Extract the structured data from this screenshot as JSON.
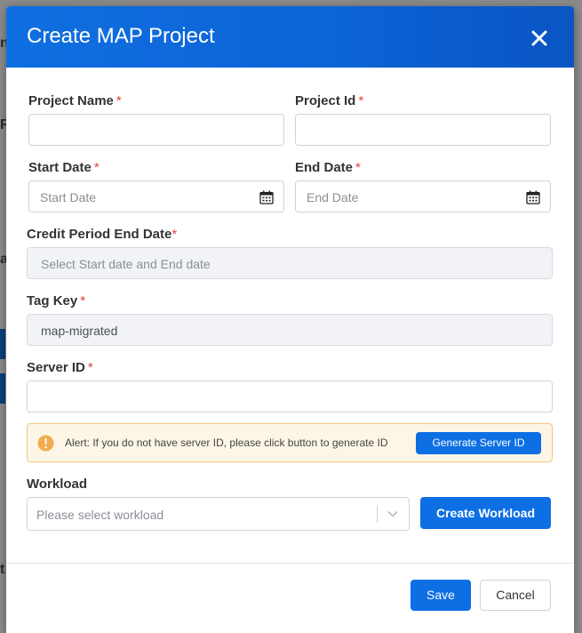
{
  "modal": {
    "title": "Create MAP Project",
    "close_icon": "close-icon"
  },
  "form": {
    "project_name": {
      "label": "Project Name",
      "required_mark": "*",
      "value": ""
    },
    "project_id": {
      "label": "Project Id",
      "required_mark": "*",
      "value": ""
    },
    "start_date": {
      "label": "Start Date",
      "required_mark": "*",
      "placeholder": "Start Date",
      "icon": "calendar-icon"
    },
    "end_date": {
      "label": "End Date",
      "required_mark": "*",
      "placeholder": "End Date",
      "icon": "calendar-icon"
    },
    "credit_period_end_date": {
      "label": "Credit Period End Date",
      "required_mark": "*",
      "placeholder": "Select Start date and End date"
    },
    "tag_key": {
      "label": "Tag Key",
      "required_mark": "*",
      "value": "map-migrated"
    },
    "server_id": {
      "label": "Server ID",
      "required_mark": "*",
      "value": ""
    },
    "alert": {
      "icon": "warning-icon",
      "text": "Alert: If you do not have server ID, please click button to generate ID",
      "button_label": "Generate Server ID"
    },
    "workload": {
      "label": "Workload",
      "placeholder": "Please select workload",
      "create_button_label": "Create Workload"
    }
  },
  "footer": {
    "save_label": "Save",
    "cancel_label": "Cancel"
  },
  "colors": {
    "header": "#0d6fe3",
    "primary_button": "#0d6fe3",
    "required": "#e0413a",
    "alert_bg": "#fdf6e7",
    "alert_border": "#f3c777",
    "alert_icon": "#f0ad4e"
  }
}
